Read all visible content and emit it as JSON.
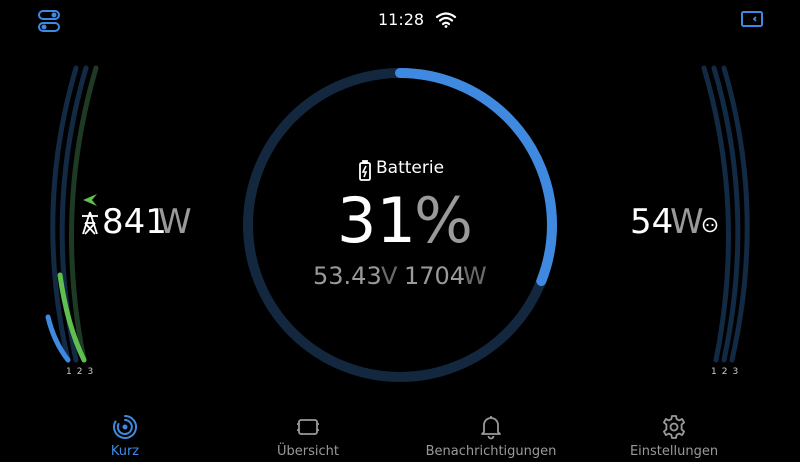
{
  "status_bar": {
    "time": "11:28"
  },
  "grid": {
    "value": "841",
    "unit": "W",
    "phase_labels": "123"
  },
  "battery": {
    "title": "Batterie",
    "soc_value": "31",
    "soc_unit": "%",
    "soc_fraction": 0.31,
    "voltage": "53.43",
    "voltage_unit": "V",
    "power": "1704",
    "power_unit": "W"
  },
  "load": {
    "value": "54",
    "unit": "W",
    "phase_labels": "123"
  },
  "colors": {
    "accent": "#3f8ae0",
    "ring_track": "#13273f",
    "grid_green": "#5fbf4f",
    "arc_dim": "#132a45"
  },
  "nav": {
    "items": [
      {
        "label": "Kurz",
        "icon": "speedometer-icon",
        "active": true
      },
      {
        "label": "Übersicht",
        "icon": "overview-icon",
        "active": false
      },
      {
        "label": "Benachrichtigungen",
        "icon": "bell-icon",
        "active": false
      },
      {
        "label": "Einstellungen",
        "icon": "gear-icon",
        "active": false
      }
    ]
  }
}
